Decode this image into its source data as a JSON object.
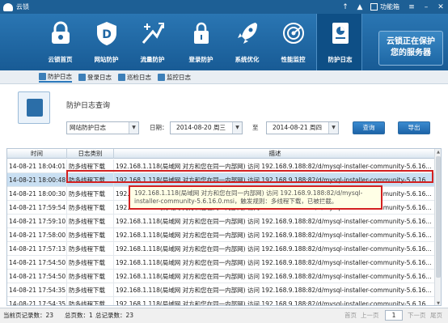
{
  "app": {
    "title": "云锁",
    "function_box": "功能箱"
  },
  "toolbar": {
    "items": [
      {
        "label": "云锁首页",
        "icon": "lock-icon"
      },
      {
        "label": "网站防护",
        "icon": "shield-d-icon"
      },
      {
        "label": "流量防护",
        "icon": "traffic-icon"
      },
      {
        "label": "登录防护",
        "icon": "padlock-icon"
      },
      {
        "label": "系统优化",
        "icon": "rocket-icon"
      },
      {
        "label": "性能监控",
        "icon": "radar-icon"
      },
      {
        "label": "防护日志",
        "icon": "log-icon"
      }
    ],
    "active_index": 6,
    "promo_line1": "云锁正在保护",
    "promo_line2": "您的服务器"
  },
  "subtabs": [
    {
      "label": "防护日志",
      "active": true
    },
    {
      "label": "登录日志",
      "active": false
    },
    {
      "label": "巡检日志",
      "active": false
    },
    {
      "label": "监控日志",
      "active": false
    }
  ],
  "query": {
    "title": "防护日志查询",
    "log_type": "网站防护日志",
    "date_label": "日期：",
    "start_date": "2014-08-20 周三",
    "to_label": "至",
    "end_date": "2014-08-21 周四",
    "query_button": "查询",
    "export_button": "导出"
  },
  "table": {
    "headers": {
      "time": "时间",
      "type": "日志类别",
      "desc": "描述"
    },
    "rows": [
      {
        "time": "14-08-21 18:04:01",
        "type": "防多线程下载",
        "desc": "192.168.1.118(局域网 对方和您在同一内部网) 访问 192.168.9.188:82/d/mysql-installer-community-5.6.16..."
      },
      {
        "time": "14-08-21 18:00:48",
        "type": "防多线程下载",
        "desc": "192.168.1.118(局域网 对方和您在同一内部网) 访问 192.168.9.188:82/d/mysql-installer-community-5.6.16..."
      },
      {
        "time": "14-08-21 18:00:30",
        "type": "防多线程下载",
        "desc": "192.168.1.118(局域网 对方和您在同一内部网) 访问 192.168.9.188:82/d/mysql-installer-community-5.6.16..."
      },
      {
        "time": "14-08-21 17:59:54",
        "type": "防多线程下载",
        "desc": "192.168.1.118(局域网 对方和您在同一内部网) 访问 192.168.9.188:82/d/mysql-installer-community-5.6.16..."
      },
      {
        "time": "14-08-21 17:59:10",
        "type": "防多线程下载",
        "desc": "192.168.1.118(局域网 对方和您在同一内部网) 访问 192.168.9.188:82/d/mysql-installer-community-5.6.16..."
      },
      {
        "time": "14-08-21 17:58:00",
        "type": "防多线程下载",
        "desc": "192.168.1.118(局域网 对方和您在同一内部网) 访问 192.168.9.188:82/d/mysql-installer-community-5.6.16..."
      },
      {
        "time": "14-08-21 17:57:13",
        "type": "防多线程下载",
        "desc": "192.168.1.118(局域网 对方和您在同一内部网) 访问 192.168.9.188:82/d/mysql-installer-community-5.6.16..."
      },
      {
        "time": "14-08-21 17:54:50",
        "type": "防多线程下载",
        "desc": "192.168.1.118(局域网 对方和您在同一内部网) 访问 192.168.9.188:82/d/mysql-installer-community-5.6.16..."
      },
      {
        "time": "14-08-21 17:54:50",
        "type": "防多线程下载",
        "desc": "192.168.1.118(局域网 对方和您在同一内部网) 访问 192.168.9.188:82/d/mysql-installer-community-5.6.16..."
      },
      {
        "time": "14-08-21 17:54:35",
        "type": "防多线程下载",
        "desc": "192.168.1.118(局域网 对方和您在同一内部网) 访问 192.168.9.188:82/d/mysql-installer-community-5.6.16..."
      },
      {
        "time": "14-08-21 17:54:35",
        "type": "防多线程下载",
        "desc": "192.168.1.118(局域网 对方和您在同一内部网) 访问 192.168.9.188:82/d/mysql-installer-community-5.6.16..."
      }
    ],
    "selected_index": 1,
    "tooltip_line1": "192.168.1.118(局域网 对方和您在同一内部网) 访问 192.168.9.188:82/d/mysql-",
    "tooltip_line2": "installer-community-5.6.16.0.msi，触发规则：多线程下载，已被拦截。"
  },
  "status": {
    "current_page_records": "当前页记录数：23",
    "total_pages": "总页数：1",
    "total_records": "总记录数：23",
    "first_page": "首页",
    "prev_page": "上一页",
    "page_number": "1",
    "next_page": "下一页",
    "last_page": "尾页"
  }
}
